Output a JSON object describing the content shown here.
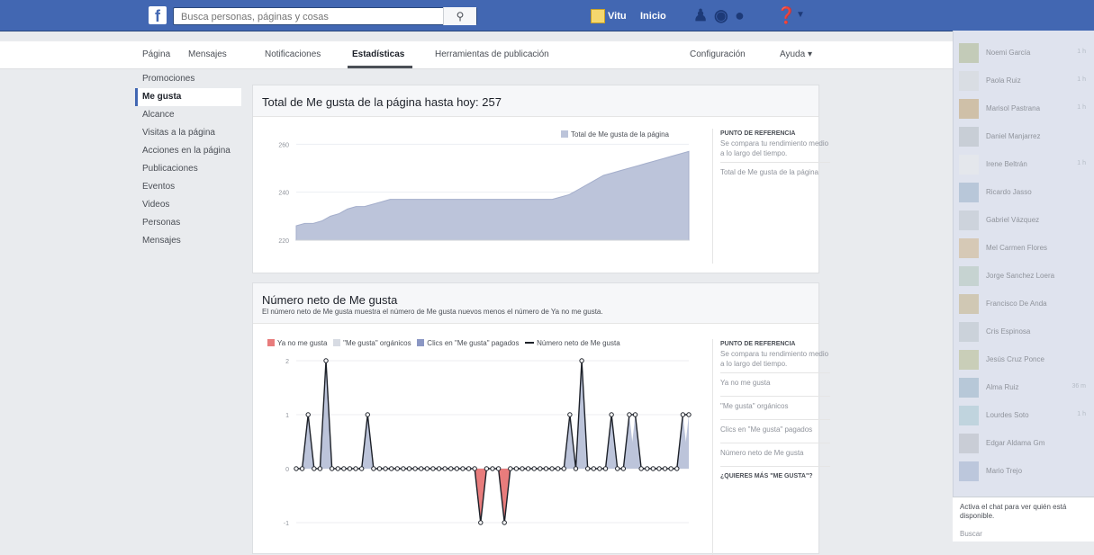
{
  "topbar": {
    "logo": "f",
    "search_placeholder": "Busca personas, páginas y cosas",
    "search_icon": "search-icon",
    "user_name": "Vitu",
    "home_label": "Inicio",
    "friends_icon": "friends-icon",
    "messages_icon": "messages-icon",
    "notifications_icon": "globe-icon",
    "help_icon": "help-icon",
    "colors": {
      "bar": "#4267b2"
    }
  },
  "page_nav": {
    "items": [
      "Página",
      "Mensajes",
      "Notificaciones",
      "Estadísticas",
      "Herramientas de publicación"
    ],
    "active": "Estadísticas",
    "settings": "Configuración",
    "help": "Ayuda ▾"
  },
  "left_nav": {
    "items": [
      "Promociones",
      "Me gusta",
      "Alcance",
      "Visitas a la página",
      "Acciones en la página",
      "Publicaciones",
      "Eventos",
      "Videos",
      "Personas",
      "Mensajes"
    ],
    "active": "Me gusta"
  },
  "card1": {
    "title": "Total de Me gusta de la página hasta hoy: 257",
    "legend": "Total de Me gusta de la página",
    "bench_header": "PUNTO DE REFERENCIA",
    "bench_text": "Se compara tu rendimiento medio a lo largo del tiempo.",
    "bench_item": "Total de Me gusta de la página"
  },
  "card2": {
    "title": "Número neto de Me gusta",
    "subtitle": "El número neto de Me gusta muestra el número de Me gusta nuevos menos el número de Ya no me gusta.",
    "legend": [
      "Ya no me gusta",
      "\"Me gusta\" orgánicos",
      "Clics en \"Me gusta\" pagados",
      "Número neto de Me gusta"
    ],
    "bench_header": "PUNTO DE REFERENCIA",
    "bench_text": "Se compara tu rendimiento medio a lo largo del tiempo.",
    "bench_items": [
      "Ya no me gusta",
      "\"Me gusta\" orgánicos",
      "Clics en \"Me gusta\" pagados",
      "Número neto de Me gusta"
    ],
    "bench_more": "¿QUIERES MÁS \"ME GUSTA\"?"
  },
  "right_panel": {
    "contacts": [
      "Noemi García",
      "Paola Ruiz",
      "Marisol Pastrana",
      "Daniel Manjarrez",
      "Irene Beltrán",
      "Ricardo Jasso",
      "Gabriel Vázquez",
      "Mel Carmen Flores",
      "Jorge Sanchez Loera",
      "Francisco De Anda",
      "Cris Espinosa",
      "Jesús Cruz Ponce",
      "Alma Ruiz",
      "Lourdes Soto",
      "Edgar Aldama Gm",
      "Mario Trejo"
    ],
    "contact_times": [
      "1 h",
      "1 h",
      "1 h",
      "",
      "1 h",
      "",
      "",
      "",
      "",
      "",
      "",
      "",
      "36 m",
      "1 h",
      "",
      ""
    ],
    "chat_text": "Activa el chat para ver quién está disponible.",
    "chat_search": "Buscar"
  },
  "chart_data": [
    {
      "type": "area",
      "title": "Total de Me gusta de la página hasta hoy: 257",
      "series": [
        {
          "name": "Total de Me gusta de la página",
          "values": [
            226,
            227,
            227,
            228,
            230,
            231,
            233,
            234,
            234,
            235,
            236,
            237,
            237,
            237,
            237,
            237,
            237,
            237,
            237,
            237,
            237,
            237,
            237,
            237,
            237,
            237,
            237,
            237,
            237,
            237,
            237,
            238,
            239,
            241,
            243,
            245,
            247,
            248,
            249,
            250,
            251,
            252,
            253,
            254,
            255,
            256,
            257
          ]
        }
      ],
      "yticks": [
        "260",
        "240",
        "220"
      ],
      "ylim": [
        220,
        262
      ],
      "colors": {
        "fill": "#bcc4da",
        "line": "#a4aecb"
      }
    },
    {
      "type": "line",
      "title": "Número neto de Me gusta",
      "series": [
        {
          "name": "Número neto de Me gusta",
          "values": [
            0,
            0,
            1,
            0,
            0,
            2,
            0,
            0,
            0,
            0,
            0,
            0,
            1,
            0,
            0,
            0,
            0,
            0,
            0,
            0,
            0,
            0,
            0,
            0,
            0,
            0,
            0,
            0,
            0,
            0,
            0,
            -1,
            0,
            0,
            0,
            -1,
            0,
            0,
            0,
            0,
            0,
            0,
            0,
            0,
            0,
            0,
            1,
            0,
            2,
            0,
            0,
            0,
            0,
            1,
            0,
            0,
            1,
            1,
            0,
            0,
            0,
            0,
            0,
            0,
            0,
            1,
            1
          ]
        }
      ],
      "yticks": [
        "2",
        "1",
        "0",
        "-1"
      ],
      "ylim": [
        -1,
        2
      ],
      "colors": {
        "positive": "#bcc4da",
        "negative": "#e87c7c",
        "line": "#1d2129"
      }
    }
  ]
}
